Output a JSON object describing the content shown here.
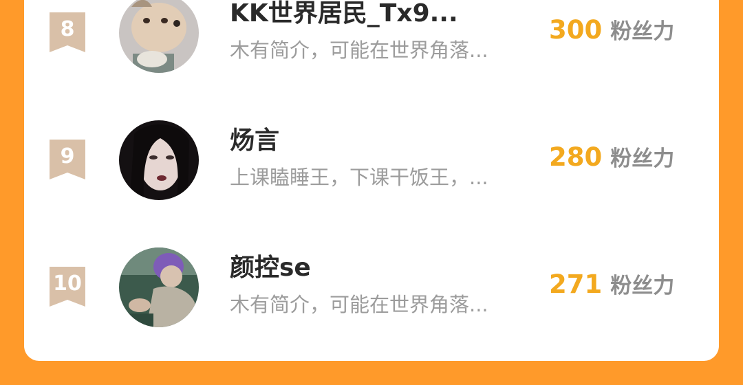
{
  "ranking": [
    {
      "rank": "8",
      "name": "KK世界居民_Tx9...",
      "bio": "木有简介，可能在世界角落...",
      "score": "300",
      "unit": "粉丝力",
      "avatar_icon": "puppy-photo"
    },
    {
      "rank": "9",
      "name": "炀言",
      "bio": "上课瞌睡王，下课干饭王，...",
      "score": "280",
      "unit": "粉丝力",
      "avatar_icon": "portrait-photo"
    },
    {
      "rank": "10",
      "name": "颜控se",
      "bio": "木有简介，可能在世界角落...",
      "score": "271",
      "unit": "粉丝力",
      "avatar_icon": "person-photo"
    }
  ],
  "colors": {
    "background": "#ff9a2a",
    "score": "#f3a91f",
    "rank_badge": "#d9c0a8"
  }
}
